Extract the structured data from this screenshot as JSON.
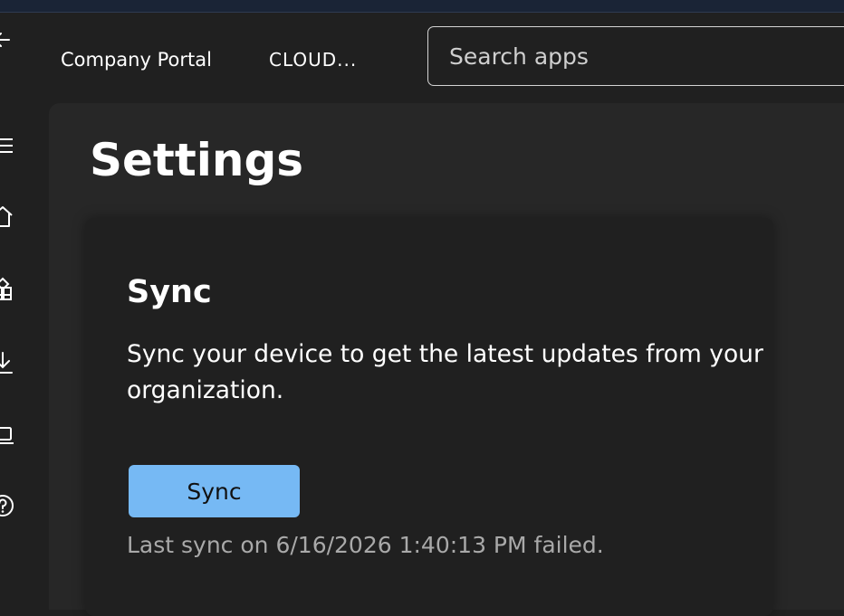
{
  "header": {
    "app_title": "Company Portal",
    "tenant_name": "CLOUD...",
    "search_placeholder": "Search apps"
  },
  "nav": {
    "items": [
      {
        "icon": "back-arrow-icon"
      },
      {
        "icon": "hamburger-menu-icon"
      },
      {
        "icon": "home-icon"
      },
      {
        "icon": "apps-icon"
      },
      {
        "icon": "downloads-icon"
      },
      {
        "icon": "devices-icon"
      },
      {
        "icon": "help-icon"
      }
    ]
  },
  "page": {
    "title": "Settings"
  },
  "sync_card": {
    "heading": "Sync",
    "description": "Sync your device to get the latest updates from your organization.",
    "button_label": "Sync",
    "status": "Last sync on 6/16/2026 1:40:13 PM failed."
  },
  "colors": {
    "background": "#202020",
    "content_surface": "#272727",
    "accent_button": "#76b9f4",
    "muted_text": "#a9a9a9"
  }
}
